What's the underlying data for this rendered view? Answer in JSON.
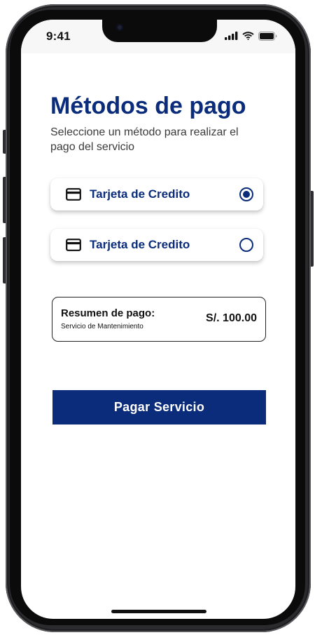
{
  "status_bar": {
    "time": "9:41",
    "icons": [
      "cellular-signal-icon",
      "wifi-icon",
      "battery-icon"
    ]
  },
  "page": {
    "title": "Métodos de pago",
    "subtitle": "Seleccione un método para realizar el pago del servicio"
  },
  "payment_methods": [
    {
      "label": "Tarjeta de Credito",
      "icon": "credit-card-icon",
      "selected": true
    },
    {
      "label": "Tarjeta de Credito",
      "icon": "credit-card-icon",
      "selected": false
    }
  ],
  "summary": {
    "title": "Resumen de pago:",
    "service": "Servicio de Mantenimiento",
    "amount": "S/. 100.00"
  },
  "actions": {
    "pay_label": "Pagar Servicio"
  },
  "colors": {
    "primary": "#0a2c7a",
    "text": "#111111",
    "subtitle": "#3a3a3a",
    "background": "#ffffff"
  }
}
